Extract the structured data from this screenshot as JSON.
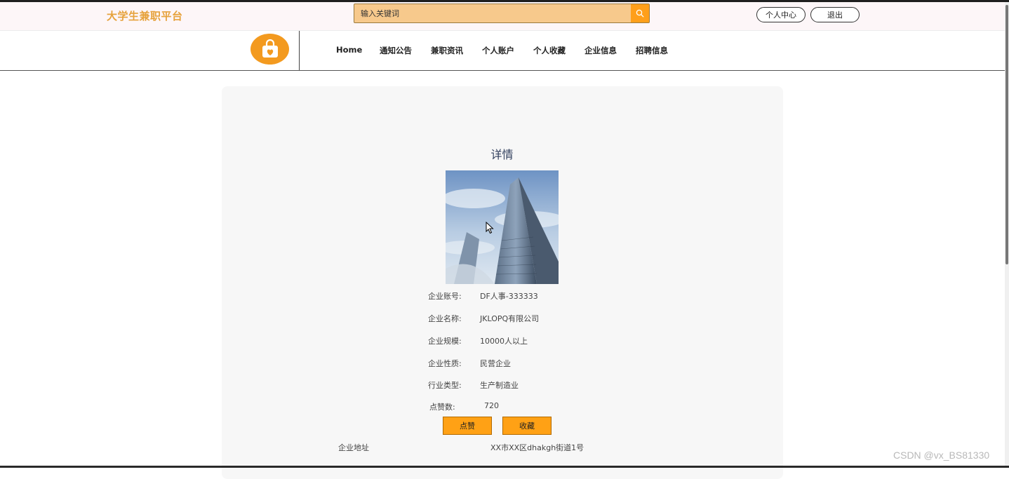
{
  "header": {
    "site_title": "大学生兼职平台",
    "search_placeholder": "输入关键词",
    "personal_center": "个人中心",
    "logout": "退出"
  },
  "nav": {
    "items": [
      "Home",
      "通知公告",
      "兼职资讯",
      "个人账户",
      "个人收藏",
      "企业信息",
      "招聘信息"
    ]
  },
  "detail": {
    "title": "详情",
    "fields": [
      {
        "label": "企业账号:",
        "value": "DF人事-333333"
      },
      {
        "label": "企业名称:",
        "value": "JKLOPQ有限公司"
      },
      {
        "label": "企业规模:",
        "value": "10000人以上"
      },
      {
        "label": "企业性质:",
        "value": "民营企业"
      },
      {
        "label": "行业类型:",
        "value": "生产制造业"
      },
      {
        "label": "点赞数:",
        "value": "720"
      }
    ],
    "like_button": "点赞",
    "favorite_button": "收藏",
    "address_label": "企业地址",
    "address_value": "XX市XX区dhakgh街道1号"
  },
  "watermark": "CSDN @vx_BS81330",
  "colors": {
    "accent": "#ff9f1a",
    "site_title": "#e6a23c",
    "logo": "#f39a1f"
  },
  "icons": {
    "search": "search-icon",
    "logo": "shopping-bag-heart-icon",
    "cursor": "mouse-pointer-icon"
  }
}
